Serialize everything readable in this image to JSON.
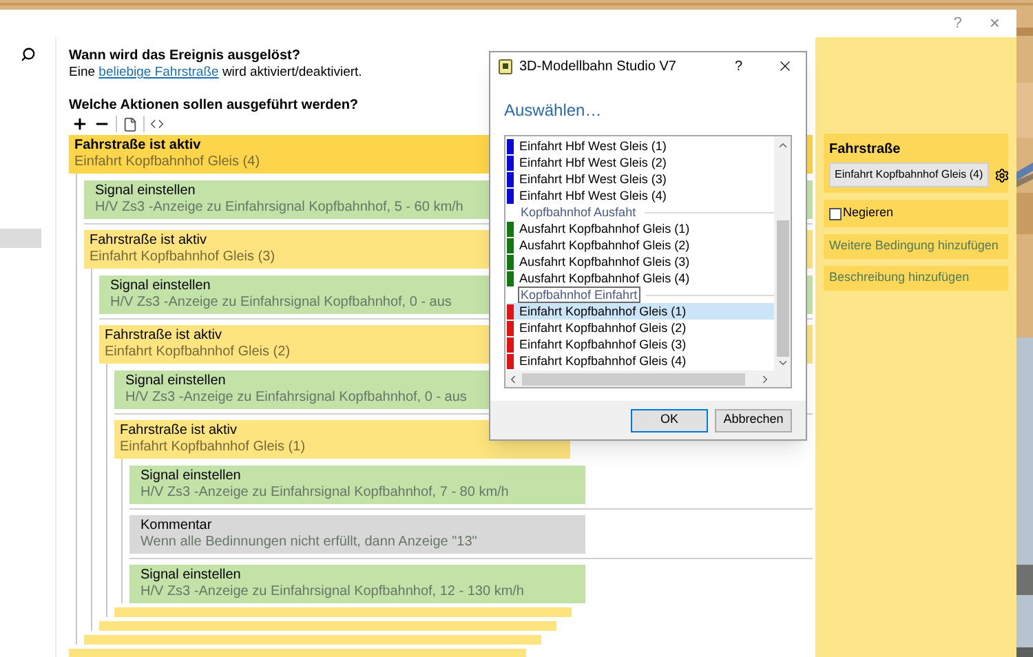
{
  "window": {
    "help": "?",
    "close": "×"
  },
  "trigger": {
    "heading": "Wann wird das Ereignis ausgelöst?",
    "prefix": "Eine",
    "link": "beliebige Fahrstraße",
    "suffix": "wird aktiviert/deaktiviert."
  },
  "actions": {
    "heading": "Welche Aktionen sollen ausgeführt werden?"
  },
  "tree": [
    {
      "kind": "condition",
      "selected": true,
      "title": "Fahrstraße ist aktiv",
      "detail": "Einfahrt Kopfbahnhof Gleis (4)",
      "children": [
        {
          "kind": "action",
          "selected": false,
          "title": "Signal einstellen",
          "detail": "H/V Zs3 -Anzeige zu Einfahrsignal Kopfbahnhof, 5 - 60 km/h"
        },
        {
          "kind": "condition",
          "selected": false,
          "title": "Fahrstraße ist aktiv",
          "detail": "Einfahrt Kopfbahnhof Gleis (3)",
          "children": [
            {
              "kind": "action",
              "selected": false,
              "title": "Signal einstellen",
              "detail": "H/V Zs3 -Anzeige zu Einfahrsignal Kopfbahnhof, 0 - aus"
            },
            {
              "kind": "condition",
              "selected": false,
              "title": "Fahrstraße ist aktiv",
              "detail": "Einfahrt Kopfbahnhof Gleis (2)",
              "children": [
                {
                  "kind": "action",
                  "selected": false,
                  "title": "Signal einstellen",
                  "detail": "H/V Zs3 -Anzeige zu Einfahrsignal Kopfbahnhof, 0 - aus"
                },
                {
                  "kind": "condition",
                  "selected": false,
                  "title": "Fahrstraße ist aktiv",
                  "detail": "Einfahrt Kopfbahnhof Gleis (1)",
                  "children": [
                    {
                      "kind": "action",
                      "selected": false,
                      "title": "Signal einstellen",
                      "detail": "H/V Zs3 -Anzeige zu Einfahrsignal Kopfbahnhof, 7 - 80 km/h"
                    },
                    {
                      "kind": "comment",
                      "selected": false,
                      "title": "Kommentar",
                      "detail": "Wenn alle Bedinnungen nicht erfüllt, dann Anzeige \"13\""
                    },
                    {
                      "kind": "action",
                      "selected": false,
                      "title": "Signal einstellen",
                      "detail": "H/V Zs3 -Anzeige zu Einfahrsignal Kopfbahnhof, 12 - 130 km/h"
                    }
                  ]
                }
              ]
            }
          ]
        }
      ]
    }
  ],
  "properties": {
    "heading": "Fahrstraße",
    "value": "Einfahrt Kopfbahnhof Gleis (4)",
    "negate": {
      "label": "Negieren",
      "checked": false
    },
    "links": [
      "Weitere Bedingung hinzufügen",
      "Beschreibung hinzufügen"
    ]
  },
  "dialog": {
    "title": "3D-Modellbahn Studio V7",
    "help": "?",
    "heading": "Auswählen…",
    "groups": [
      {
        "items": [
          {
            "label": "Einfahrt Hbf West Gleis (1)",
            "color": "#0a0ad8",
            "selected": false
          },
          {
            "label": "Einfahrt Hbf West Gleis (2)",
            "color": "#0a0ad8",
            "selected": false
          },
          {
            "label": "Einfahrt Hbf West Gleis (3)",
            "color": "#0a0ad8",
            "selected": false
          },
          {
            "label": "Einfahrt Hbf West Gleis (4)",
            "color": "#0a0ad8",
            "selected": false
          }
        ]
      },
      {
        "label": "Kopfbahnhof Ausfaht",
        "focused": false,
        "items": [
          {
            "label": "Ausfahrt Kopfbahnhof Gleis (1)",
            "color": "#137813",
            "selected": false
          },
          {
            "label": "Ausfahrt Kopfbahnhof Gleis (2)",
            "color": "#137813",
            "selected": false
          },
          {
            "label": "Ausfahrt Kopfbahnhof Gleis (3)",
            "color": "#137813",
            "selected": false
          },
          {
            "label": "Ausfahrt Kopfbahnhof Gleis (4)",
            "color": "#137813",
            "selected": false
          }
        ]
      },
      {
        "label": "Kopfbahnhof Einfahrt",
        "focused": true,
        "items": [
          {
            "label": "Einfahrt Kopfbahnhof Gleis (1)",
            "color": "#e01414",
            "selected": true
          },
          {
            "label": "Einfahrt Kopfbahnhof Gleis (2)",
            "color": "#e01414",
            "selected": false
          },
          {
            "label": "Einfahrt Kopfbahnhof Gleis (3)",
            "color": "#e01414",
            "selected": false
          },
          {
            "label": "Einfahrt Kopfbahnhof Gleis (4)",
            "color": "#e01414",
            "selected": false
          }
        ]
      }
    ],
    "buttons": [
      {
        "label": "OK",
        "default": true
      },
      {
        "label": "Abbrechen",
        "default": false
      }
    ]
  }
}
